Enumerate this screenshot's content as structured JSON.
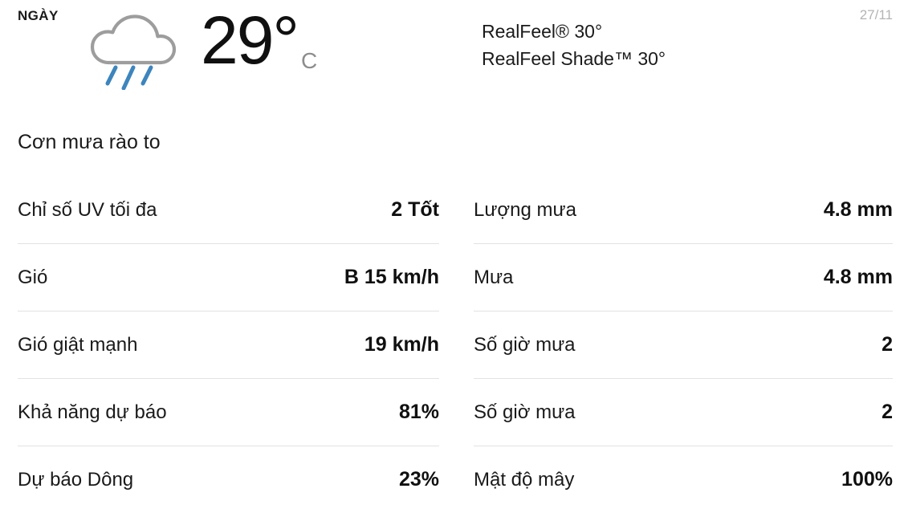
{
  "header": {
    "day_label": "NGÀY",
    "weather_icon": "rain-cloud-icon",
    "temperature": "29°",
    "temperature_unit": "C",
    "realfeel": "RealFeel® 30°",
    "realfeel_shade": "RealFeel Shade™ 30°",
    "date": "27/11"
  },
  "summary": {
    "condition": "Cơn mưa rào to"
  },
  "colors": {
    "text": "#1a1a1a",
    "muted": "#8d8d8d",
    "date": "#b4b4b4",
    "divider": "#e2e2e2",
    "cloud_outline": "#9d9d9d",
    "rain": "#3d85bd",
    "background": "#ffffff"
  },
  "details": {
    "left": [
      {
        "label": "Chỉ số UV tối đa",
        "value": "2 Tốt"
      },
      {
        "label": "Gió",
        "value": "B 15 km/h"
      },
      {
        "label": "Gió giật mạnh",
        "value": "19 km/h"
      },
      {
        "label": "Khả năng dự báo",
        "value": "81%"
      },
      {
        "label": "Dự báo Dông",
        "value": "23%"
      }
    ],
    "right": [
      {
        "label": "Lượng mưa",
        "value": "4.8 mm"
      },
      {
        "label": "Mưa",
        "value": "4.8 mm"
      },
      {
        "label": "Số giờ mưa",
        "value": "2"
      },
      {
        "label": "Số giờ mưa",
        "value": "2"
      },
      {
        "label": "Mật độ mây",
        "value": "100%"
      }
    ]
  }
}
